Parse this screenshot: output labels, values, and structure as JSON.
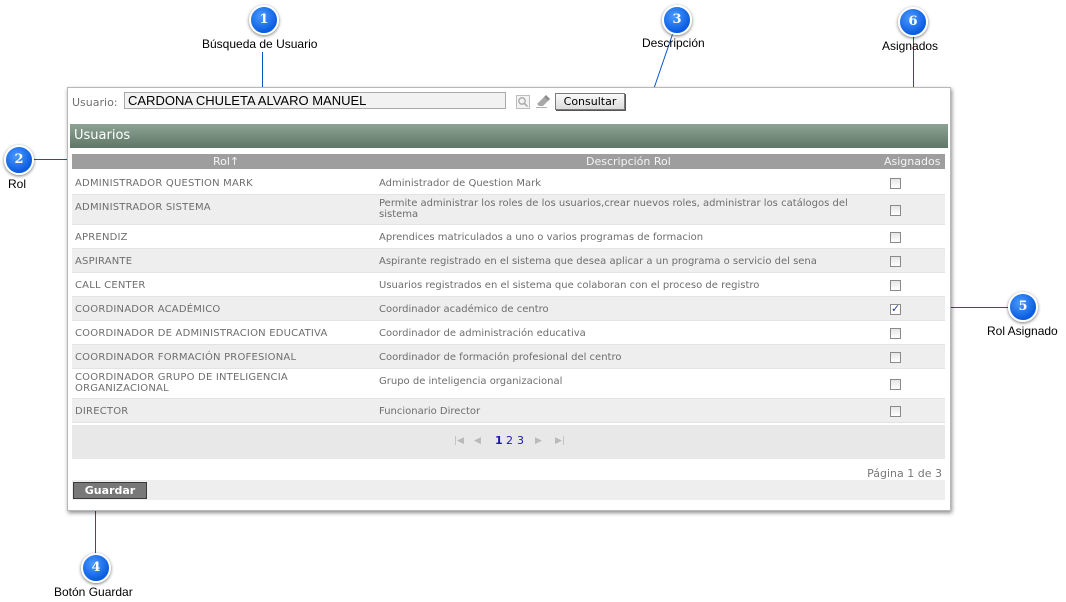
{
  "callouts": [
    {
      "num": "1",
      "label": "Búsqueda de Usuario"
    },
    {
      "num": "2",
      "label": "Rol"
    },
    {
      "num": "3",
      "label": "Descripción"
    },
    {
      "num": "4",
      "label": "Botón Guardar"
    },
    {
      "num": "5",
      "label": "Rol Asignado"
    },
    {
      "num": "6",
      "label": "Asignados"
    }
  ],
  "search": {
    "label": "Usuario:",
    "value": "CARDONA CHULETA ALVARO MANUEL",
    "button_label": "Consultar"
  },
  "panel_title": "Usuarios",
  "table": {
    "headers": [
      "Rol↑",
      "Descripción Rol",
      "Asignados"
    ],
    "rows": [
      {
        "rol": "ADMINISTRADOR QUESTION MARK",
        "descripcion": "Administrador de Question Mark",
        "asignado": false
      },
      {
        "rol": "ADMINISTRADOR SISTEMA",
        "descripcion": "Permite administrar los roles de los usuarios,crear nuevos roles, administrar los catálogos del sistema",
        "asignado": false
      },
      {
        "rol": "APRENDIZ",
        "descripcion": "Aprendices matriculados a uno o varios programas de formacion",
        "asignado": false
      },
      {
        "rol": "ASPIRANTE",
        "descripcion": "Aspirante registrado en el sistema que desea aplicar a un programa o servicio del sena",
        "asignado": false
      },
      {
        "rol": "CALL CENTER",
        "descripcion": "Usuarios registrados en el sistema que colaboran con el proceso de registro",
        "asignado": false
      },
      {
        "rol": "COORDINADOR ACADÉMICO",
        "descripcion": "Coordinador académico de centro",
        "asignado": true
      },
      {
        "rol": "COORDINADOR DE ADMINISTRACION EDUCATIVA",
        "descripcion": "Coordinador de administración educativa",
        "asignado": false
      },
      {
        "rol": "COORDINADOR FORMACIÓN PROFESIONAL",
        "descripcion": "Coordinador de formación profesional del centro",
        "asignado": false
      },
      {
        "rol": "COORDINADOR GRUPO DE INTELIGENCIA ORGANIZACIONAL",
        "descripcion": "Grupo de inteligencia organizacional",
        "asignado": false
      },
      {
        "rol": "DIRECTOR",
        "descripcion": "Funcionario Director",
        "asignado": false
      }
    ]
  },
  "pagination": {
    "pages": [
      "1",
      "2",
      "3"
    ],
    "current_page": 1,
    "info": "Página 1 de 3"
  },
  "save_button": "Guardar",
  "colors": {
    "callout": "#0a5ce0",
    "header_bar": "#6f8777",
    "column_header": "#9e9e9e"
  }
}
